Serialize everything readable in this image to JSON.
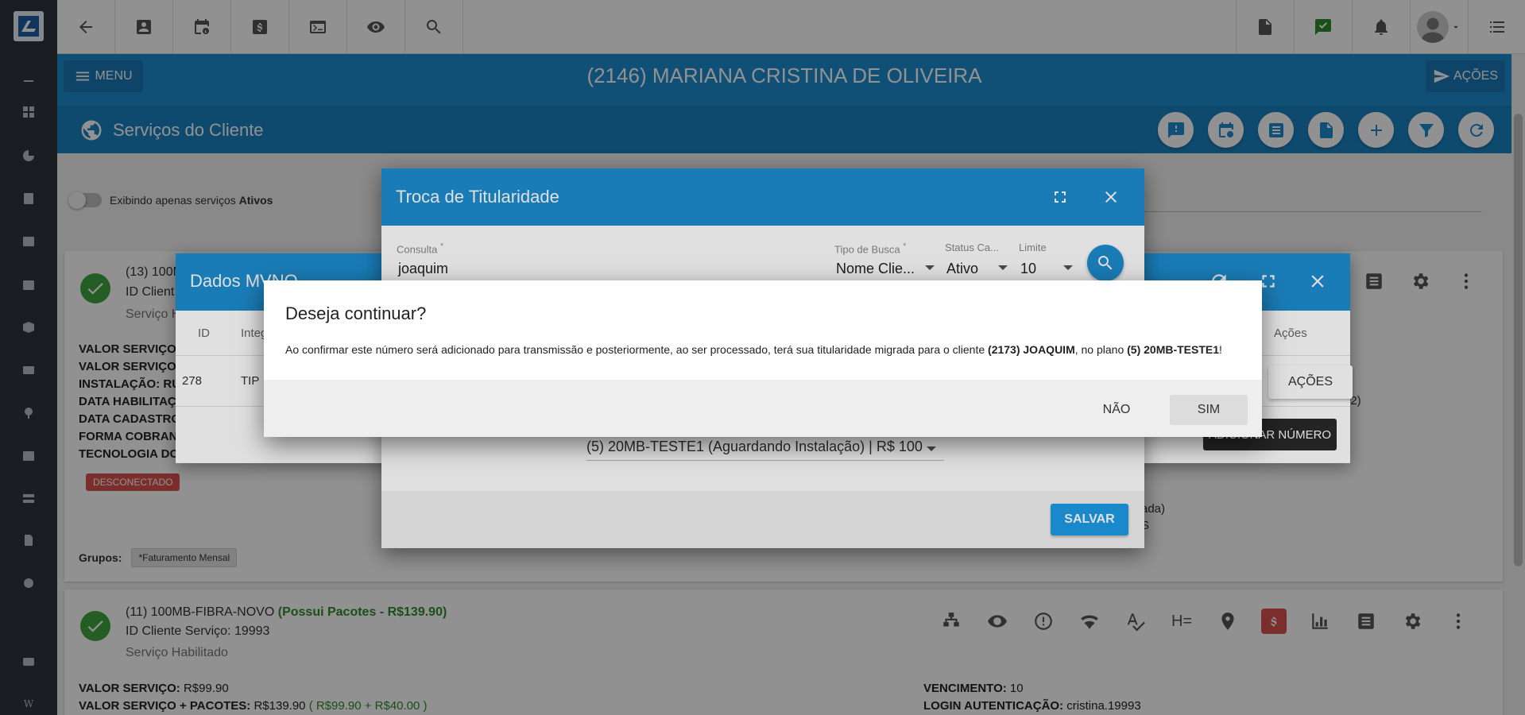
{
  "app": {
    "client_title": "(2146) MARIANA CRISTINA DE OLIVEIRA",
    "menu_label": "MENU",
    "acoes_label": "AÇÕES",
    "section_title": "Serviços do Cliente"
  },
  "filter": {
    "toggle_text_prefix": "Exibindo apenas serviços ",
    "toggle_text_bold": "Ativos"
  },
  "card1": {
    "header": "(13) 100M",
    "id_label": "ID Client",
    "status": "Serviço H",
    "fields": [
      "VALOR SERVIÇO:",
      "VALOR SERVIÇO +",
      "INSTALAÇÃO: RU",
      "DATA HABILITAÇ",
      "DATA CADASTRO",
      "FORMA COBRANC",
      "TECNOLOGIA DO"
    ],
    "badge": "DESCONECTADO",
    "groups_label": "Grupos:",
    "group_tag": "*Faturamento Mensal",
    "right_frag_1": "72)",
    "right_frag_2": "ada)",
    "right_frag_3": "S"
  },
  "card2": {
    "header_name": "(11) 100MB-FIBRA-NOVO ",
    "header_pkg": "(Possui Pacotes - R$139.90)",
    "id_line": "ID Cliente Serviço: 19993",
    "status": "Serviço Habilitado",
    "valor_label": "VALOR SERVIÇO:",
    "valor_value": " R$99.90",
    "valor_pac_label": "VALOR SERVIÇO + PACOTES:",
    "valor_pac_value": " R$139.90 ",
    "valor_pac_detail": "( R$99.90 + R$40.00 )",
    "venc_label": "VENCIMENTO:",
    "venc_value": " 10",
    "login_label": "LOGIN AUTENTICAÇÃO:",
    "login_value": " cristina.19993"
  },
  "mvno": {
    "title": "Dados MVNO",
    "columns": [
      "ID",
      "Integ",
      "Ações"
    ],
    "row": {
      "id": "278",
      "integ": "TIP"
    },
    "acoes_button": "AÇÕES",
    "add_number_button": "ADICIONAR NÚMERO"
  },
  "troca": {
    "title": "Troca de Titularidade",
    "consulta_label": "Consulta",
    "consulta_value": "joaquim",
    "tipo_label": "Tipo de Busca",
    "tipo_value": "Nome Clie...",
    "status_label": "Status Ca...",
    "status_value": "Ativo",
    "limite_label": "Limite",
    "limite_value": "10",
    "required_mark": "*",
    "plan_value": "(5) 20MB-TESTE1 (Aguardando Instalação) | R$ 100",
    "save_button": "SALVAR"
  },
  "confirm": {
    "title": "Deseja continuar?",
    "msg_part1": "Ao confirmar este número será adicionado para transmissão e posteriormente, ao ser processado, terá sua titularidade migrada para o cliente ",
    "msg_client": "(2173) JOAQUIM",
    "msg_part2": ", no plano ",
    "msg_plan": "(5) 20MB-TESTE1",
    "msg_end": "!",
    "no_button": "NÃO",
    "yes_button": "SIM"
  },
  "colors": {
    "primary": "#1e8ed0",
    "sidebar": "#2f353d",
    "success": "#3fa63f",
    "danger": "#d9534f"
  }
}
